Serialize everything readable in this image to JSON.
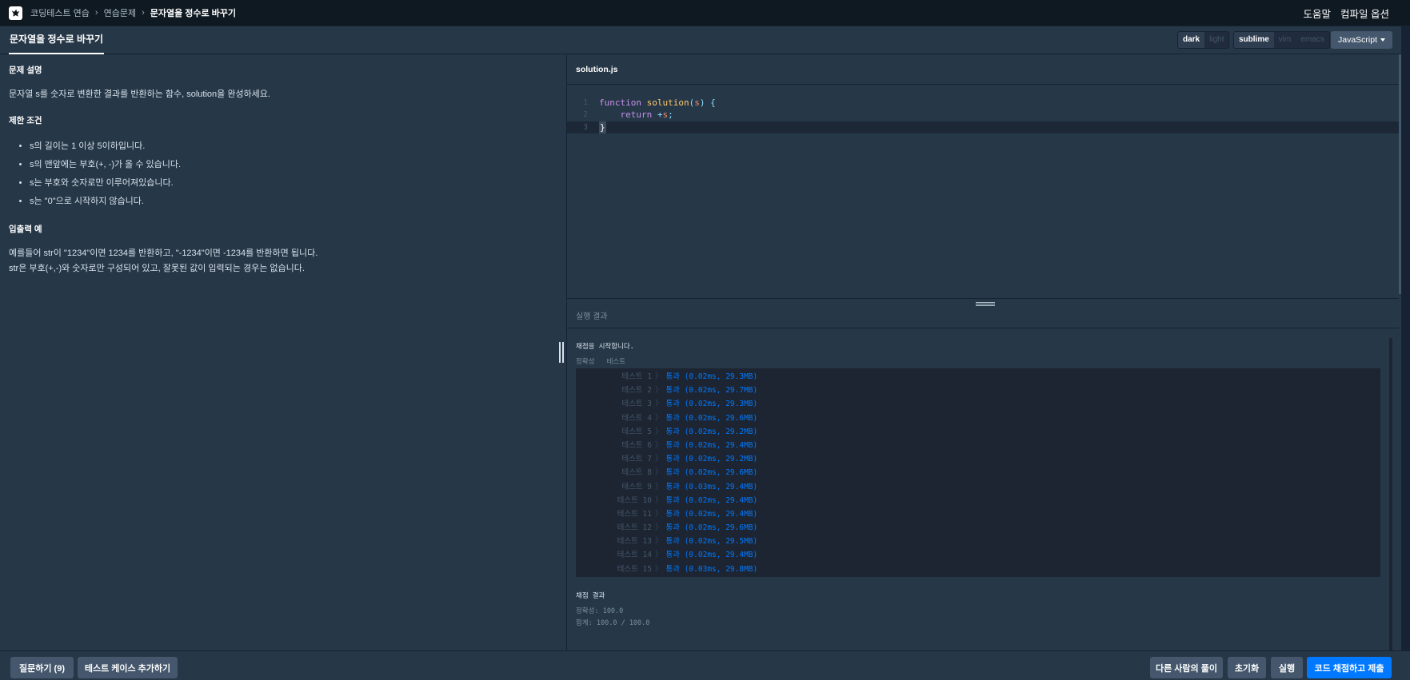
{
  "nav": {
    "crumbs": [
      "코딩테스트 연습",
      "연습문제",
      "문자열을 정수로 바꾸기"
    ],
    "help": "도움말",
    "compile_options": "컴파일 옵션"
  },
  "tabbar": {
    "title": "문자열을 정수로 바꾸기",
    "themes": [
      "dark",
      "light"
    ],
    "keymaps": [
      "sublime",
      "vim",
      "emacs"
    ],
    "language": "JavaScript"
  },
  "problem": {
    "desc_title": "문제 설명",
    "desc": "문자열 s를 숫자로 변환한 결과를 반환하는 함수, solution을 완성하세요.",
    "constraints_title": "제한 조건",
    "constraints": [
      "s의 길이는 1 이상 5이하입니다.",
      "s의 맨앞에는 부호(+, -)가 올 수 있습니다.",
      "s는 부호와 숫자로만 이루어져있습니다.",
      "s는 \"0\"으로 시작하지 않습니다."
    ],
    "io_title": "입출력 예",
    "io_lines": [
      "예를들어 str이 \"1234\"이면 1234를 반환하고, \"-1234\"이면 -1234를 반환하면 됩니다.",
      "str은 부호(+,-)와 숫자로만 구성되어 있고, 잘못된 값이 입력되는 경우는 없습니다."
    ]
  },
  "editor": {
    "filename": "solution.js",
    "line_numbers": [
      "1",
      "2",
      "3"
    ]
  },
  "result": {
    "header": "실행 결과",
    "start": "채점을 시작합니다.",
    "sub": [
      "정확성",
      "테스트"
    ],
    "tests": [
      {
        "name": "테스트 1",
        "res": "통과 (0.02ms, 29.3MB)"
      },
      {
        "name": "테스트 2",
        "res": "통과 (0.02ms, 29.7MB)"
      },
      {
        "name": "테스트 3",
        "res": "통과 (0.02ms, 29.3MB)"
      },
      {
        "name": "테스트 4",
        "res": "통과 (0.02ms, 29.6MB)"
      },
      {
        "name": "테스트 5",
        "res": "통과 (0.02ms, 29.2MB)"
      },
      {
        "name": "테스트 6",
        "res": "통과 (0.02ms, 29.4MB)"
      },
      {
        "name": "테스트 7",
        "res": "통과 (0.02ms, 29.2MB)"
      },
      {
        "name": "테스트 8",
        "res": "통과 (0.02ms, 29.6MB)"
      },
      {
        "name": "테스트 9",
        "res": "통과 (0.03ms, 29.4MB)"
      },
      {
        "name": "테스트 10",
        "res": "통과 (0.02ms, 29.4MB)"
      },
      {
        "name": "테스트 11",
        "res": "통과 (0.02ms, 29.4MB)"
      },
      {
        "name": "테스트 12",
        "res": "통과 (0.02ms, 29.6MB)"
      },
      {
        "name": "테스트 13",
        "res": "통과 (0.02ms, 29.5MB)"
      },
      {
        "name": "테스트 14",
        "res": "통과 (0.02ms, 29.4MB)"
      },
      {
        "name": "테스트 15",
        "res": "통과 (0.03ms, 29.8MB)"
      }
    ],
    "final_title": "채점 결과",
    "accuracy": "정확성: 100.0",
    "total": "합계: 100.0 / 100.0"
  },
  "buttons": {
    "question": "질문하기 (9)",
    "add_testcase": "테스트 케이스 추가하기",
    "others": "다른 사람의 풀이",
    "reset": "초기화",
    "run": "실행",
    "submit": "코드 채점하고 제출"
  },
  "colors": {
    "background": "#263747",
    "nav": "#0f1921",
    "accent": "#0078ff",
    "button": "#44576c"
  }
}
